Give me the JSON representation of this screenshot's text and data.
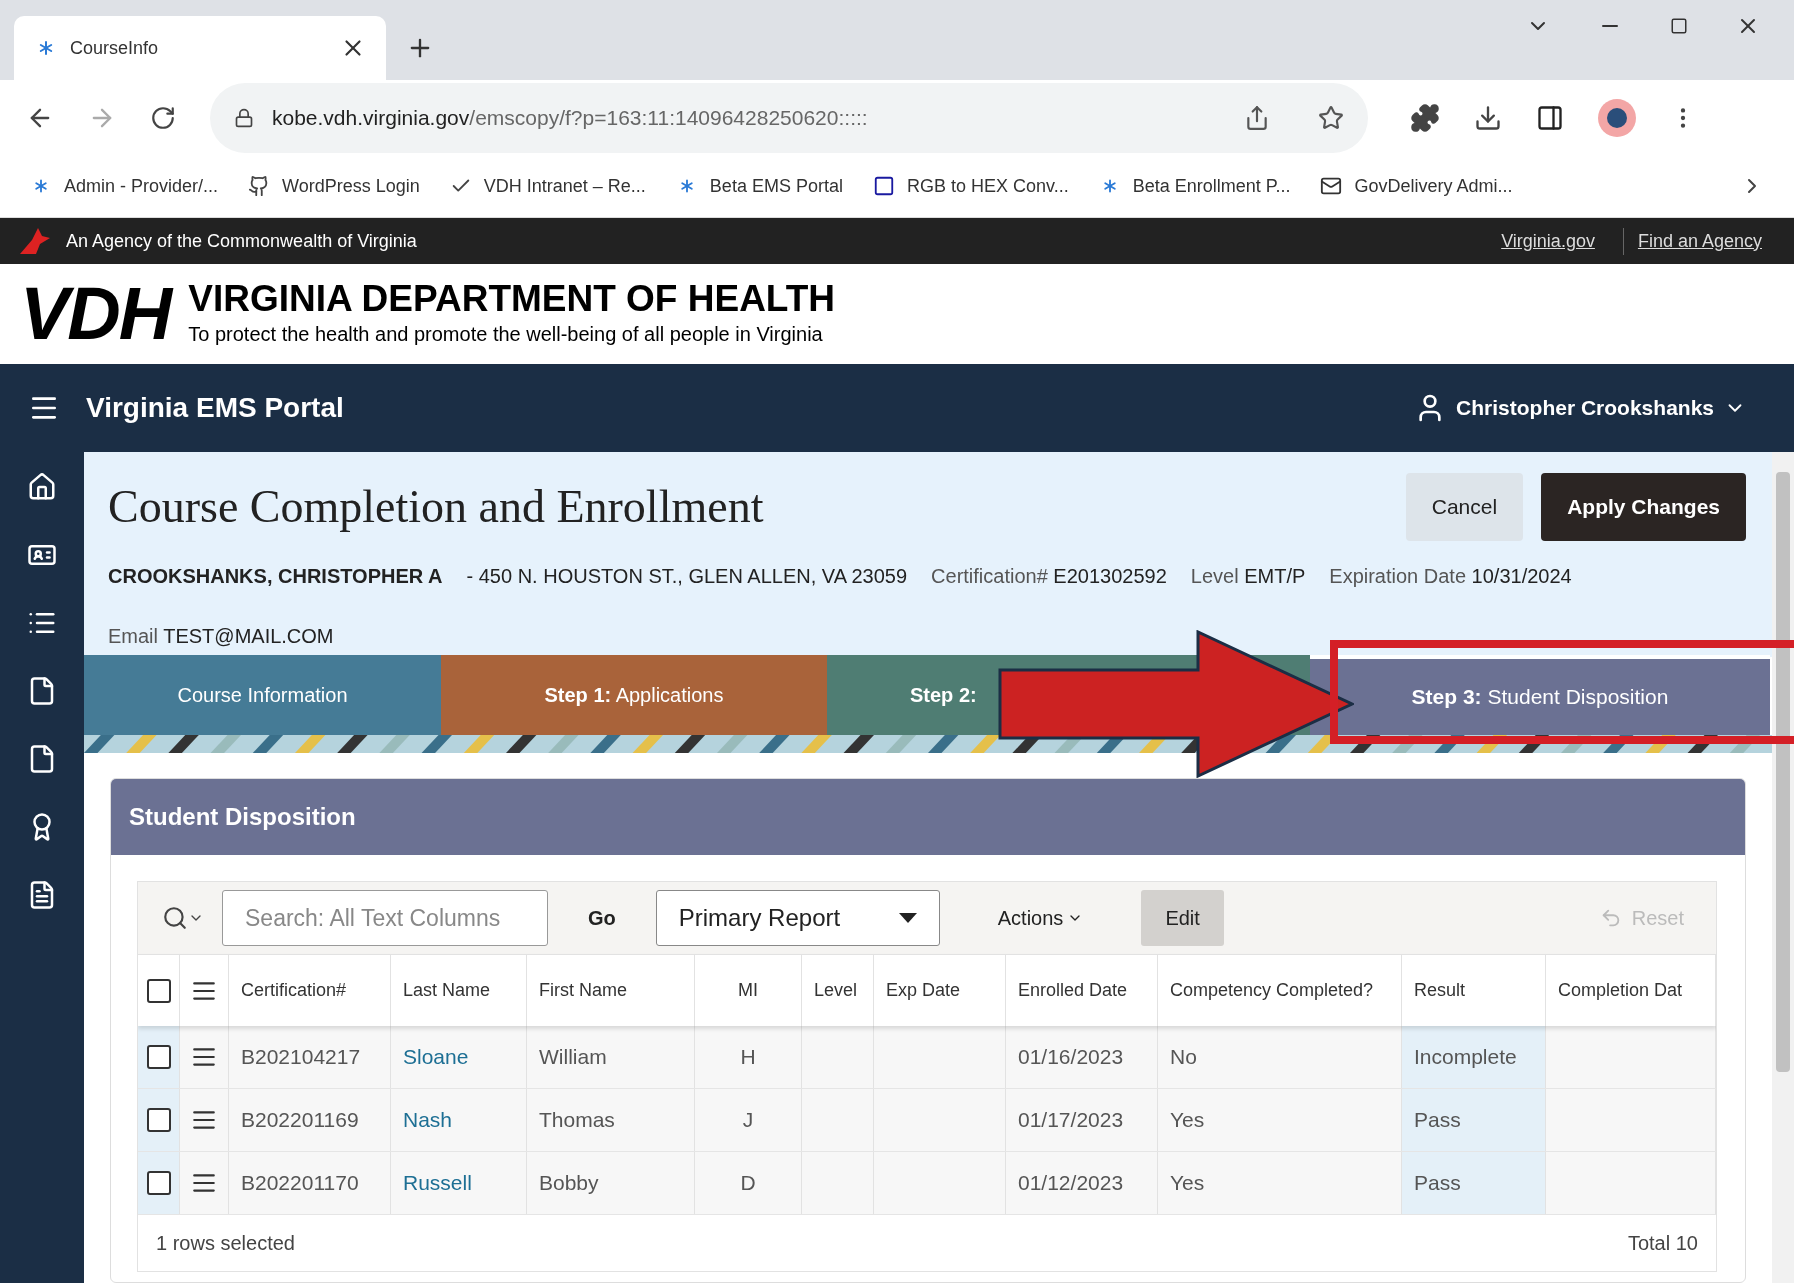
{
  "browser": {
    "tab_title": "CourseInfo",
    "url_host": "kobe.vdh.virginia.gov",
    "url_path": "/emscopy/f?p=163:11:14096428250620:::::",
    "bookmarks": [
      "Admin - Provider/...",
      "WordPress Login",
      "VDH Intranet – Re...",
      "Beta EMS Portal",
      "RGB to HEX Conv...",
      "Beta Enrollment P...",
      "GovDelivery Admi..."
    ]
  },
  "agency_bar": {
    "text": "An Agency of the Commonwealth of Virginia",
    "links": [
      "Virginia.gov",
      "Find an Agency"
    ]
  },
  "header": {
    "logo": "VDH",
    "title": "VIRGINIA DEPARTMENT OF HEALTH",
    "tagline": "To protect the health and promote the well-being of all people in Virginia"
  },
  "nav": {
    "app_title": "Virginia EMS Portal",
    "user": "Christopher Crookshanks"
  },
  "page": {
    "title": "Course Completion and Enrollment",
    "buttons": [
      "Cancel",
      "Apply Changes"
    ],
    "name": "CROOKSHANKS, CHRISTOPHER A",
    "address": "- 450 N. HOUSTON ST., GLEN ALLEN, VA 23059",
    "fields": [
      {
        "label": "Certification#",
        "value": "E201302592"
      },
      {
        "label": "Level",
        "value": "EMT/P"
      },
      {
        "label": "Expiration Date",
        "value": "10/31/2024"
      }
    ],
    "email": {
      "label": "Email",
      "value": "TEST@MAIL.COM"
    }
  },
  "steps": [
    {
      "label": "Course Information",
      "color": "#457b96",
      "selected": false
    },
    {
      "label": "**Step 1:** Applications",
      "color": "#a9633a",
      "selected": false
    },
    {
      "label": "**Step 2:**",
      "color": "#4f7d73",
      "selected": false
    },
    {
      "label": "**Step 3:** Student Disposition",
      "color": "#6b7193",
      "selected": true
    }
  ],
  "region": {
    "title": "Student Disposition",
    "select_all_checked": false,
    "toolbar": {
      "search_placeholder": "Search: All Text Columns",
      "go": "Go",
      "report": "Primary Report",
      "actions": "Actions",
      "edit": "Edit",
      "reset": "Reset"
    },
    "columns": [
      "Certification#",
      "Last Name",
      "First Name",
      "MI",
      "Level",
      "Exp Date",
      "Enrolled Date",
      "Competency Completed?",
      "Result",
      "Completion Dat"
    ],
    "rows": [
      {
        "checked": false,
        "cells": [
          "B202104217",
          "Sloane",
          "William",
          "H",
          "",
          "",
          "01/16/2023",
          "No",
          "Incomplete",
          ""
        ]
      },
      {
        "checked": false,
        "cells": [
          "B202201169",
          "Nash",
          "Thomas",
          "J",
          "",
          "",
          "01/17/2023",
          "Yes",
          "Pass",
          ""
        ]
      },
      {
        "checked": false,
        "cells": [
          "B202201170",
          "Russell",
          "Bobby",
          "D",
          "",
          "",
          "01/12/2023",
          "Yes",
          "Pass",
          ""
        ]
      }
    ],
    "footer_left": "1 rows selected",
    "footer_right": "Total 10"
  }
}
